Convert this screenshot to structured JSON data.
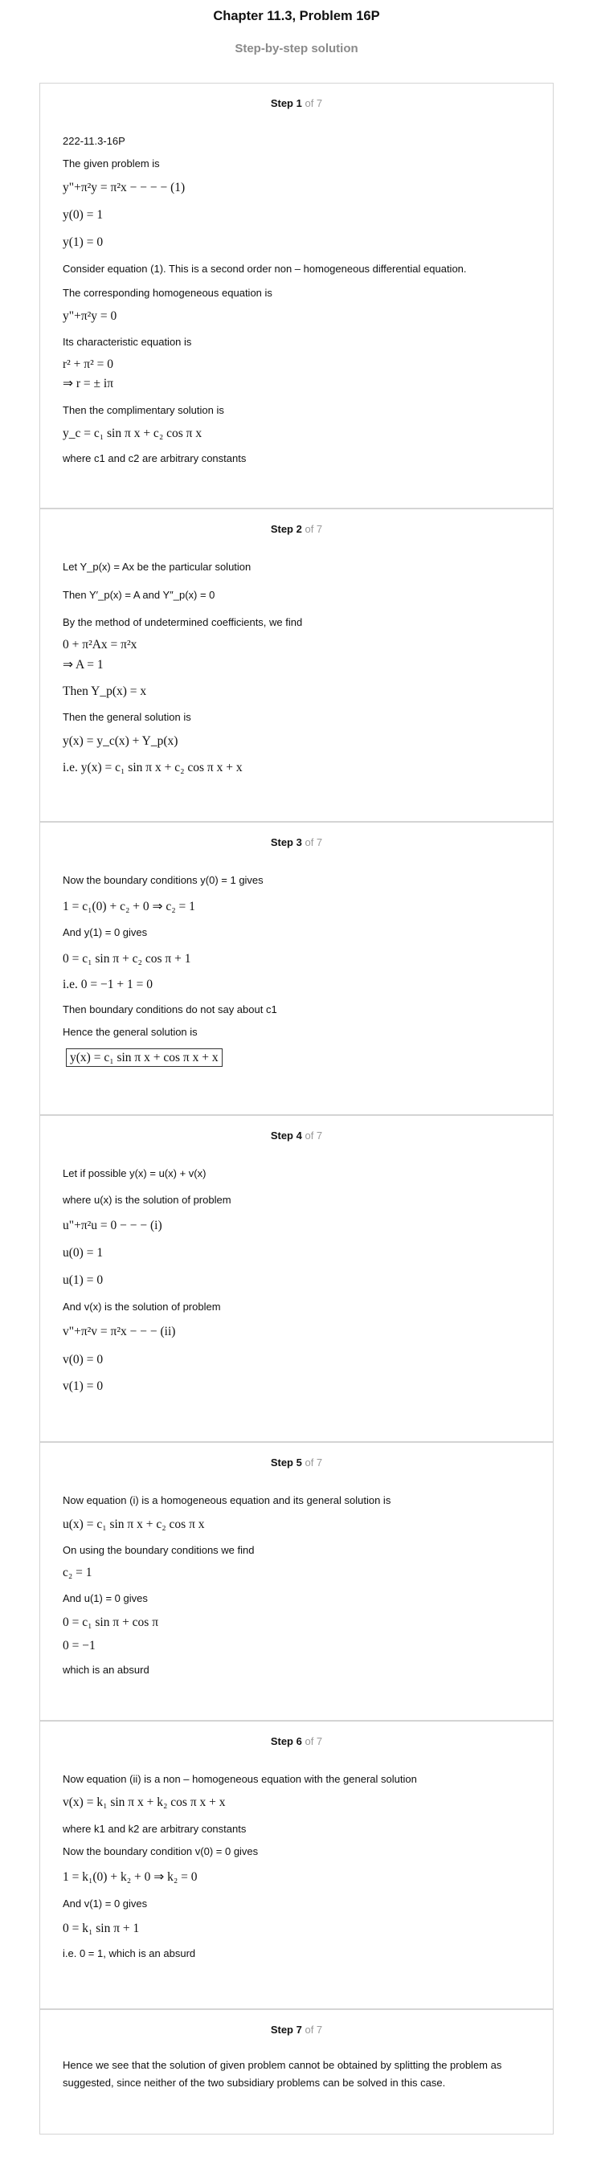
{
  "title": "Chapter 11.3, Problem 16P",
  "subtitle": "Step-by-step solution",
  "steps": [
    {
      "label": "Step 1",
      "of": "of 7",
      "lines": [
        "222-11.3-16P",
        "The given problem is",
        "y\"+π²y = π²x − − − − (1)",
        "y(0) = 1",
        "y(1) = 0",
        "Consider equation (1). This is a second order non – homogeneous differential equation.",
        "The corresponding homogeneous equation is",
        "y\"+π²y = 0",
        "Its characteristic equation is",
        "r² + π² = 0",
        "⇒ r = ± iπ",
        "Then the complimentary solution is",
        "y_c = c₁ sin π x + c₂ cos π x",
        "where c1 and c2 are arbitrary constants"
      ]
    },
    {
      "label": "Step 2",
      "of": "of 7",
      "lines": [
        "Let Y_p(x) = Ax be the particular solution",
        "Then Y′_p(x) = A and Y″_p(x) = 0",
        "By the method of undetermined coefficients, we find",
        "0 + π²Ax = π²x",
        "⇒ A = 1",
        "Then Y_p(x) = x",
        "Then the general solution is",
        "y(x) = y_c(x) + Y_p(x)",
        "i.e. y(x) = c₁ sin π x + c₂ cos π x + x"
      ]
    },
    {
      "label": "Step 3",
      "of": "of 7",
      "lines": [
        "Now the boundary conditions y(0) = 1 gives",
        "1 = c₁(0) + c₂ + 0 ⇒ c₂ = 1",
        "And y(1) = 0 gives",
        "0 = c₁ sin π + c₂ cos π + 1",
        "i.e. 0 = −1 + 1 = 0",
        "Then boundary conditions do not say about c1",
        "Hence the general solution is",
        "y(x) = c₁ sin π x + cos π x + x"
      ]
    },
    {
      "label": "Step 4",
      "of": "of 7",
      "lines": [
        "Let if possible y(x) = u(x) + v(x)",
        "where u(x) is the solution of problem",
        "u\"+π²u = 0 − − − (i)",
        "u(0) = 1",
        "u(1) = 0",
        "And v(x) is the solution of problem",
        "v\"+π²v = π²x − − − (ii)",
        "v(0) = 0",
        "v(1) = 0"
      ]
    },
    {
      "label": "Step 5",
      "of": "of 7",
      "lines": [
        "Now equation (i) is a homogeneous equation and its general solution is",
        "u(x) = c₁ sin π x + c₂ cos π x",
        "On using the boundary conditions we find",
        "c₂ = 1",
        "And u(1) = 0 gives",
        "0 = c₁ sin π + cos π",
        "0 = −1",
        "which is an absurd"
      ]
    },
    {
      "label": "Step 6",
      "of": "of 7",
      "lines": [
        "Now equation (ii) is a non – homogeneous equation with the general solution",
        "v(x) = k₁ sin π x + k₂ cos π x + x",
        "where k1 and k2 are arbitrary constants",
        "Now the boundary condition v(0) = 0 gives",
        "1 = k₁(0) + k₂ + 0 ⇒ k₂ = 0",
        "And v(1) = 0 gives",
        "0 = k₁ sin π + 1",
        "i.e. 0 = 1, which is an absurd"
      ]
    },
    {
      "label": "Step 7",
      "of": "of 7",
      "lines": [
        "Hence we see that the solution of given problem cannot be obtained by splitting the problem as suggested, since neither of the two subsidiary problems can be solved in this case."
      ]
    }
  ]
}
